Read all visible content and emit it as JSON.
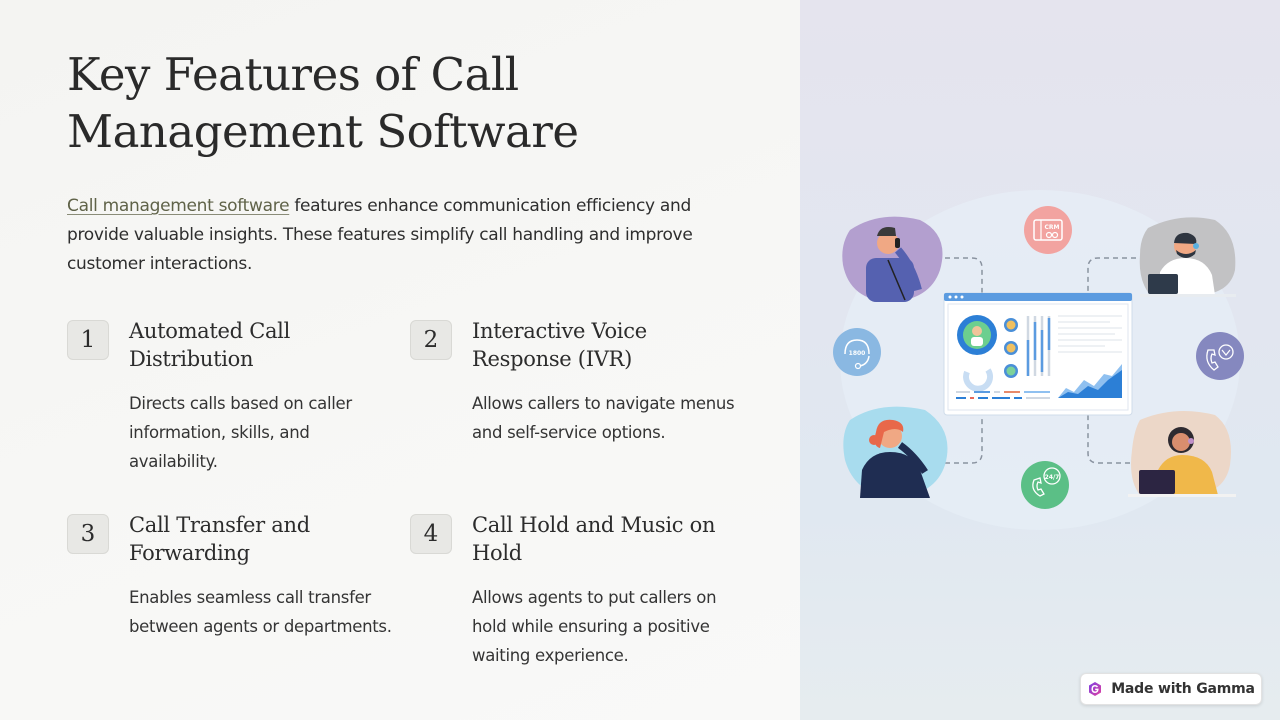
{
  "slide": {
    "title": "Key Features of Call Management Software",
    "intro": {
      "link_text": "Call management software",
      "rest_text": " features enhance communication efficiency and provide valuable insights. These features simplify call handling and improve customer interactions."
    },
    "features": [
      {
        "number": "1",
        "title": "Automated Call Distribution",
        "description": "Directs calls based on caller information, skills, and availability."
      },
      {
        "number": "2",
        "title": "Interactive Voice Response (IVR)",
        "description": "Allows callers to navigate menus and self-service options."
      },
      {
        "number": "3",
        "title": "Call Transfer and Forwarding",
        "description": "Enables seamless call transfer between agents or departments."
      },
      {
        "number": "4",
        "title": "Call Hold and Music on Hold",
        "description": "Allows agents to put callers on hold while ensuring a positive waiting experience."
      }
    ]
  },
  "illustration": {
    "icon_labels": {
      "crm": "CRM",
      "tollfree": "1800",
      "support247": "24/7"
    },
    "colors": {
      "crm_bg": "#f2a3a0",
      "tollfree_bg": "#8ab8e2",
      "support247_bg": "#5bbf86",
      "routing_bg": "#8588bf",
      "dashboard_accent": "#5b9be0"
    }
  },
  "badge": {
    "label": "Made with Gamma"
  }
}
